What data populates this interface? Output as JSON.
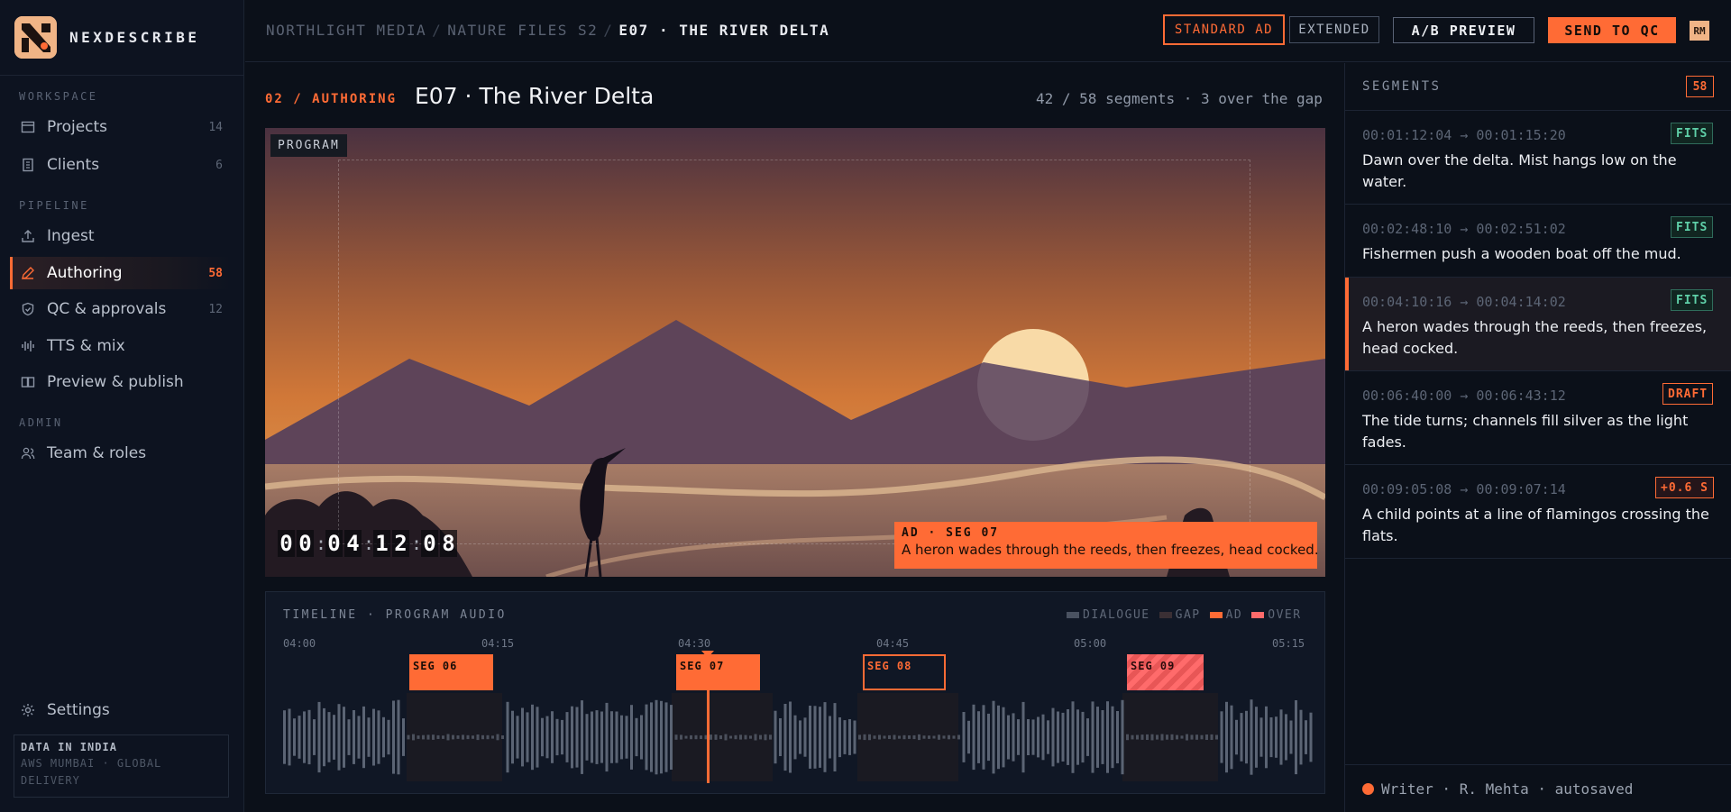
{
  "brand": {
    "name": "NEXDESCRIBE"
  },
  "sidebar": {
    "sections": [
      "WORKSPACE",
      "PIPELINE",
      "ADMIN"
    ],
    "items": [
      {
        "label": "Projects",
        "count": "14",
        "icon": "folder-icon"
      },
      {
        "label": "Clients",
        "count": "6",
        "icon": "building-icon"
      },
      {
        "label": "Ingest",
        "count": "",
        "icon": "upload-icon"
      },
      {
        "label": "Authoring",
        "count": "58",
        "icon": "pen-icon",
        "active": true
      },
      {
        "label": "QC & approvals",
        "count": "12",
        "icon": "shield-check-icon"
      },
      {
        "label": "TTS & mix",
        "count": "",
        "icon": "audio-waveform-icon"
      },
      {
        "label": "Preview & publish",
        "count": "",
        "icon": "book-open-icon"
      },
      {
        "label": "Team & roles",
        "count": "",
        "icon": "users-icon"
      }
    ],
    "settings": "Settings",
    "data_notice": {
      "title": "DATA IN INDIA",
      "line1": "AWS MUMBAI · GLOBAL",
      "line2": "DELIVERY"
    }
  },
  "topbar": {
    "breadcrumb": [
      "NORTHLIGHT MEDIA",
      "NATURE FILES S2",
      "E07 · THE RIVER DELTA"
    ],
    "buttons": {
      "standard_ad": "STANDARD AD",
      "extended": "EXTENDED",
      "ab_preview": "A/B PREVIEW",
      "send_qc": "SEND TO QC"
    },
    "avatar": "RM"
  },
  "main": {
    "step": "02 / AUTHORING",
    "title": "E07 · The River Delta",
    "summary": "42 / 58 segments · 3 over the gap"
  },
  "program": {
    "label": "PROGRAM",
    "timecode": [
      "00",
      "04",
      "12",
      "08"
    ],
    "ad_caption": {
      "header": "AD · SEG 07",
      "text": "A heron wades through the reeds, then freezes, head cocked."
    }
  },
  "timeline": {
    "title": "TIMELINE · PROGRAM AUDIO",
    "legend": [
      {
        "label": "DIALOGUE",
        "color": "#4a5261"
      },
      {
        "label": "GAP",
        "color": "#3a2f34"
      },
      {
        "label": "AD",
        "color": "#ff6b35"
      },
      {
        "label": "OVER",
        "color": "#ff6b6b"
      }
    ],
    "ticks": [
      "04:00",
      "04:15",
      "04:30",
      "04:45",
      "05:00",
      "05:15"
    ],
    "segments": [
      {
        "label": "SEG 06",
        "style": "filled"
      },
      {
        "label": "SEG 07",
        "style": "filled"
      },
      {
        "label": "SEG 08",
        "style": "outline"
      },
      {
        "label": "SEG 09",
        "style": "over"
      }
    ]
  },
  "segments_panel": {
    "title": "SEGMENTS",
    "count": "58",
    "items": [
      {
        "timecode": "00:01:12:04 → 00:01:15:20",
        "status": "FITS",
        "text": "Dawn over the delta. Mist hangs low on the water."
      },
      {
        "timecode": "00:02:48:10 → 00:02:51:02",
        "status": "FITS",
        "text": "Fishermen push a wooden boat off the mud."
      },
      {
        "timecode": "00:04:10:16 → 00:04:14:02",
        "status": "FITS",
        "text": "A heron wades through the reeds, then freezes, head cocked.",
        "active": true
      },
      {
        "timecode": "00:06:40:00 → 00:06:43:12",
        "status": "DRAFT",
        "text": "The tide turns; channels fill silver as the light fades."
      },
      {
        "timecode": "00:09:05:08 → 00:09:07:14",
        "status": "+0.6 S",
        "text": "A child points at a line of flamingos crossing the flats."
      }
    ],
    "footer": "Writer · R. Mehta · autosaved"
  }
}
